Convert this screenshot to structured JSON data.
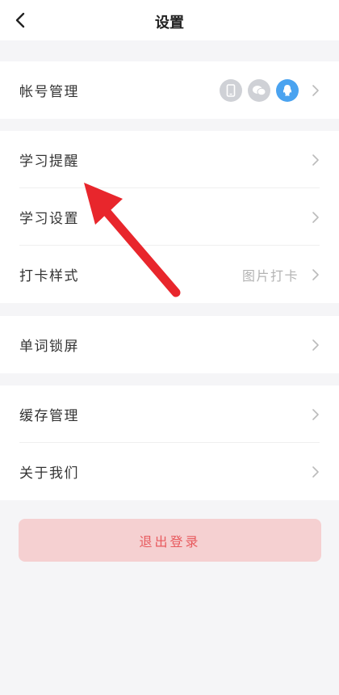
{
  "header": {
    "title": "设置"
  },
  "groups": [
    {
      "items": [
        {
          "label": "帐号管理"
        }
      ]
    },
    {
      "items": [
        {
          "label": "学习提醒"
        },
        {
          "label": "学习设置"
        },
        {
          "label": "打卡样式",
          "value": "图片打卡"
        }
      ]
    },
    {
      "items": [
        {
          "label": "单词锁屏"
        }
      ]
    },
    {
      "items": [
        {
          "label": "缓存管理"
        },
        {
          "label": "关于我们"
        }
      ]
    }
  ],
  "account_bindings": [
    {
      "icon": "phone-icon",
      "active": false
    },
    {
      "icon": "wechat-icon",
      "active": false
    },
    {
      "icon": "qq-icon",
      "active": true
    }
  ],
  "logout": {
    "label": "退出登录"
  },
  "colors": {
    "accent_blue": "#4aa3f0",
    "logout_bg": "#f5d0d1",
    "logout_text": "#e85a5e",
    "annotation_arrow": "#e8262c"
  }
}
